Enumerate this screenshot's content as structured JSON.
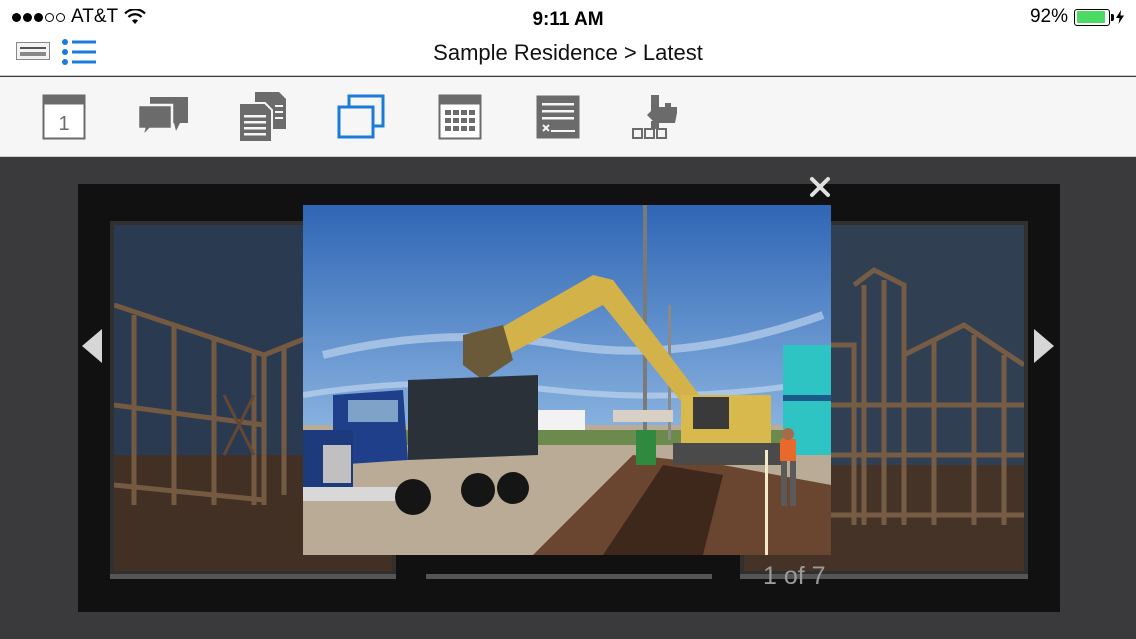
{
  "status_bar": {
    "carrier": "AT&T",
    "time": "9:11 AM",
    "battery_percent": "92%",
    "battery_level": 0.92,
    "signal_bars_filled": 3,
    "signal_bars_total": 5
  },
  "nav": {
    "title": "Sample Residence > Latest",
    "logo_icon": "foremost-logo-icon",
    "menu_icon": "list-icon"
  },
  "toolbar": {
    "tools": [
      {
        "name": "calendar-day",
        "icon": "calendar-day-icon",
        "day": "1"
      },
      {
        "name": "messages",
        "icon": "chat-bubbles-icon"
      },
      {
        "name": "documents",
        "icon": "documents-icon"
      },
      {
        "name": "photos",
        "icon": "photos-icon",
        "active": true
      },
      {
        "name": "schedule",
        "icon": "calendar-grid-icon"
      },
      {
        "name": "signoff",
        "icon": "signature-form-icon"
      },
      {
        "name": "selections",
        "icon": "hand-select-icon"
      }
    ],
    "active_color": "#1a7bd8",
    "icon_color": "#6b6b6b"
  },
  "viewer": {
    "counter": "1 of 7",
    "close_icon": "close-icon",
    "prev_icon": "chevron-left-icon",
    "next_icon": "chevron-right-icon"
  }
}
